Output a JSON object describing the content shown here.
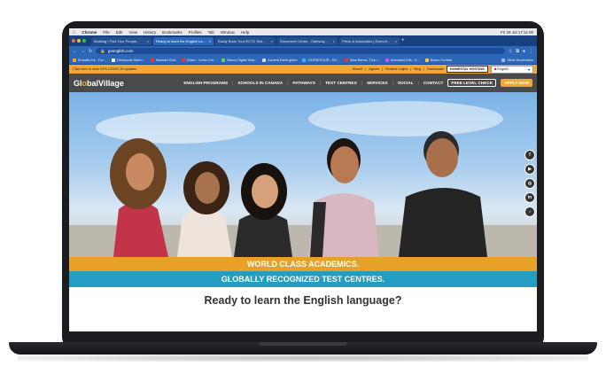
{
  "os_menubar": {
    "items": [
      "Chrome",
      "File",
      "Edit",
      "View",
      "History",
      "Bookmarks",
      "Profiles",
      "Tab",
      "Window",
      "Help"
    ],
    "datetime": "Fri 29 Jul 17:11:00"
  },
  "browser": {
    "tabs": [
      {
        "label": "Building I Find Your People...",
        "active": false
      },
      {
        "label": "Ready to learn the English La...",
        "active": true
      },
      {
        "label": "Easily Book Your IELTS Test ...",
        "active": false
      },
      {
        "label": "Document Centre - Gateway ...",
        "active": false
      },
      {
        "label": "Press & Associates | Executi...",
        "active": false
      }
    ],
    "new_tab": "+",
    "url": "gvenglish.com",
    "bookmarks": [
      "Emkalle Ink - For...",
      "Obiolocola Santo...",
      "Walmart Club",
      "iClaro - Como Cre...",
      "Banco Digital Visa...",
      "Ancient Earth globe",
      "CARREFOUR - Re...",
      "Waa Banca, This I...",
      "Animated Gifs - K...",
      "Banco Central"
    ],
    "other_bookmarks": "Other Bookmarks"
  },
  "site": {
    "covid_notice": "Click here to view GV's COVID-19 updates",
    "top_links": [
      "Alumni",
      "Agents",
      "Student Logins",
      "Blog",
      "Downloads"
    ],
    "homestay_button": "HOMESTAY HOSTING",
    "language": "English",
    "logo": {
      "part1": "Gl",
      "part2": "o",
      "part3": "balVillage"
    },
    "nav": [
      "ENGLISH PROGRAMS",
      "SCHOOLS IN CANADA",
      "PATHWAYS",
      "TEST CENTRES",
      "SERVICES",
      "SOCIAL",
      "CONTACT"
    ],
    "free_level_check": "FREE LEVEL CHECK",
    "apply_now": "APPLY NOW",
    "social_icons": [
      "f",
      "▶",
      "◎",
      "in",
      "♪"
    ],
    "banner1": "WORLD CLASS ACADEMICS.",
    "banner2": "GLOBALLY RECOGNIZED TEST CENTRES.",
    "headline": "Ready to learn the English language?"
  },
  "colors": {
    "accent_orange": "#e8a128",
    "accent_teal": "#239dc1",
    "nav_dark": "#4a4a4a",
    "browser_blue": "#2e67b7"
  }
}
